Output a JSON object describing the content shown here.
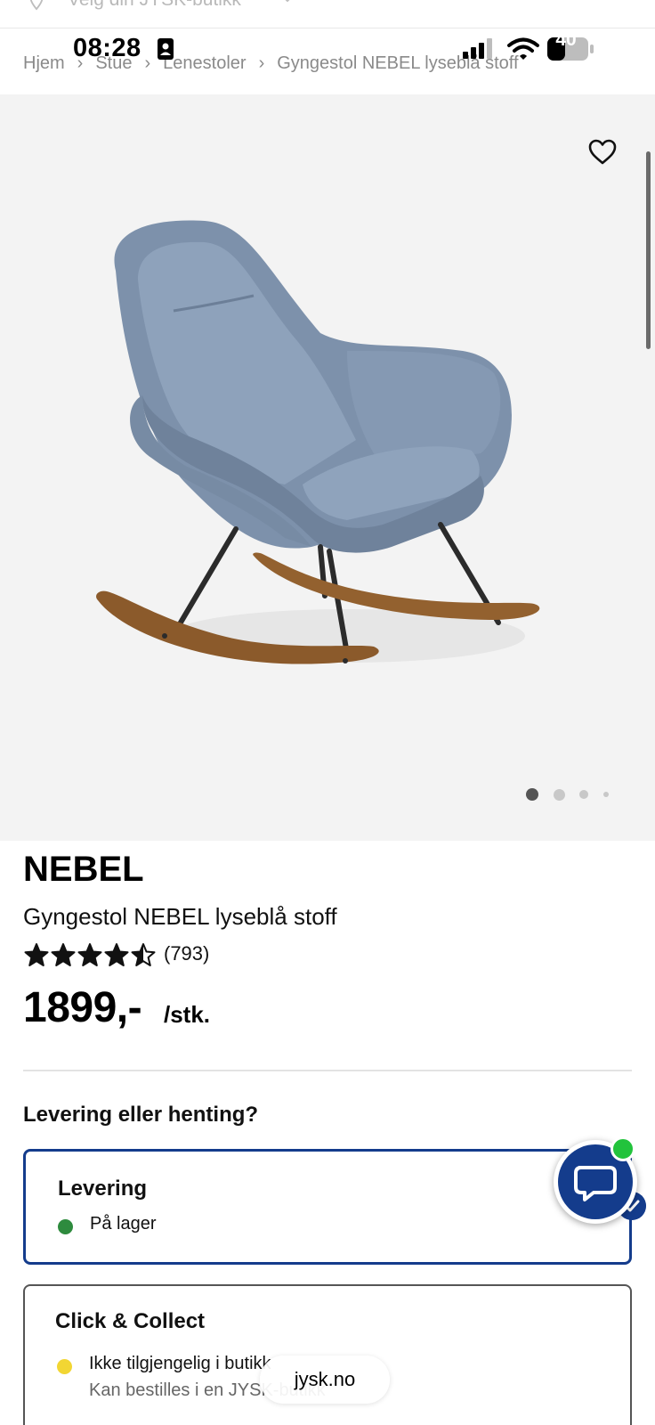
{
  "store_selector": {
    "label": "Velg din JYSK-butikk",
    "icon": "location-pin-icon"
  },
  "status_bar": {
    "time": "08:28",
    "battery": "40"
  },
  "breadcrumb": {
    "items": [
      "Hjem",
      "Stue",
      "Lenestoler",
      "Gyngestol NEBEL lyseblå stoff"
    ]
  },
  "gallery": {
    "image_count": 4,
    "active_index": 0,
    "favorite_icon": "heart-outline-icon"
  },
  "product": {
    "brand": "NEBEL",
    "name": "Gyngestol NEBEL lyseblå stoff",
    "rating": 4.5,
    "review_count": "(793)",
    "price": "1899,-",
    "price_unit": "/stk."
  },
  "delivery": {
    "heading": "Levering eller henting?",
    "options": [
      {
        "title": "Levering",
        "status": "På lager",
        "status_color": "#2e8b3e",
        "selected": true
      },
      {
        "title": "Click & Collect",
        "status": "Ikke tilgjengelig i butikk",
        "sub": "Kan bestilles i en JYSK-butikk",
        "status_color": "#f2d633",
        "selected": false
      }
    ]
  },
  "chat": {
    "icon": "chat-bubble-icon",
    "online_color": "#22c33c"
  },
  "browser": {
    "url": "jysk.no"
  },
  "colors": {
    "accent": "#143c8c",
    "chair": "#7f93ad",
    "gallery_bg": "#f3f3f3"
  }
}
